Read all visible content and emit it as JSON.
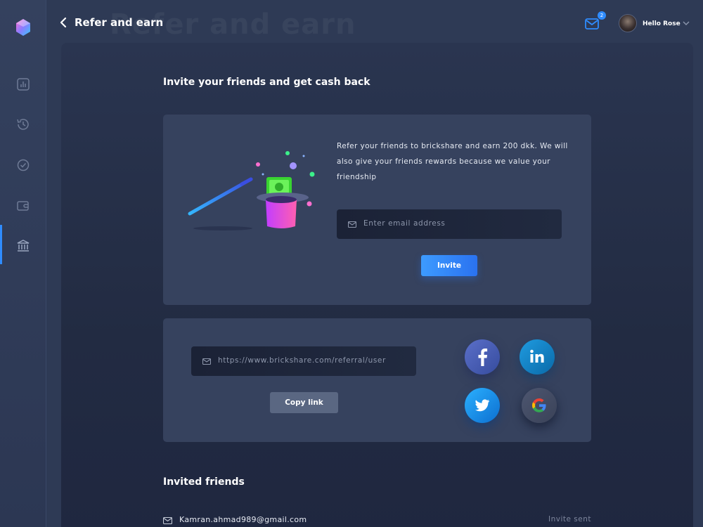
{
  "header": {
    "title": "Refer and earn",
    "ghost_title": "Refer and earn",
    "mail_badge": "2",
    "user_greeting": "Hello Rose"
  },
  "sidebar": {
    "items": [
      {
        "icon": "chart-icon"
      },
      {
        "icon": "history-icon"
      },
      {
        "icon": "check-circle-icon"
      },
      {
        "icon": "wallet-icon"
      },
      {
        "icon": "bank-icon",
        "active": true
      }
    ]
  },
  "invite": {
    "heading": "Invite your friends and get cash back",
    "description": "Refer your friends to brickshare and earn 200 dkk. We will also give your friends rewards because we value your friendship",
    "email_placeholder": "Enter email address",
    "invite_button": "Invite"
  },
  "share": {
    "referral_link": "https://www.brickshare.com/referral/user",
    "copy_button": "Copy link",
    "networks": [
      "facebook-icon",
      "linkedin-icon",
      "twitter-icon",
      "google-icon"
    ]
  },
  "invited": {
    "heading": "Invited friends",
    "rows": [
      {
        "email": "Kamran.ahmad989@gmail.com",
        "status": "Invite sent"
      }
    ]
  },
  "colors": {
    "accent": "#2f8cff",
    "background": "#2e3a55",
    "card": "#36425e",
    "content": "#232c44"
  }
}
